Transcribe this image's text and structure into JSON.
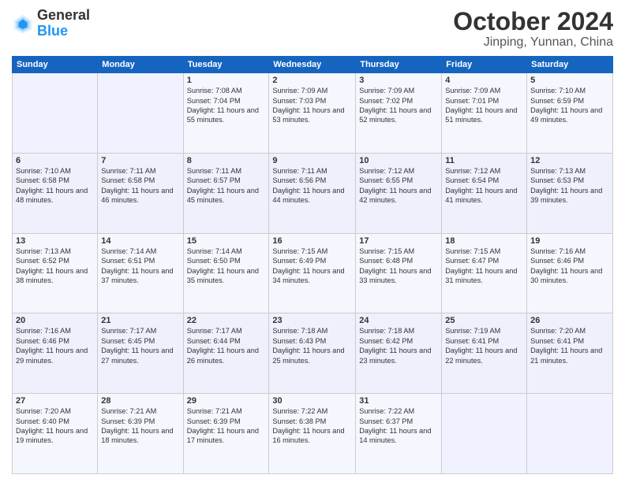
{
  "header": {
    "logo_line1": "General",
    "logo_line2": "Blue",
    "title": "October 2024",
    "subtitle": "Jinping, Yunnan, China"
  },
  "columns": [
    "Sunday",
    "Monday",
    "Tuesday",
    "Wednesday",
    "Thursday",
    "Friday",
    "Saturday"
  ],
  "weeks": [
    [
      {
        "day": "",
        "sunrise": "",
        "sunset": "",
        "daylight": ""
      },
      {
        "day": "",
        "sunrise": "",
        "sunset": "",
        "daylight": ""
      },
      {
        "day": "1",
        "sunrise": "Sunrise: 7:08 AM",
        "sunset": "Sunset: 7:04 PM",
        "daylight": "Daylight: 11 hours and 55 minutes."
      },
      {
        "day": "2",
        "sunrise": "Sunrise: 7:09 AM",
        "sunset": "Sunset: 7:03 PM",
        "daylight": "Daylight: 11 hours and 53 minutes."
      },
      {
        "day": "3",
        "sunrise": "Sunrise: 7:09 AM",
        "sunset": "Sunset: 7:02 PM",
        "daylight": "Daylight: 11 hours and 52 minutes."
      },
      {
        "day": "4",
        "sunrise": "Sunrise: 7:09 AM",
        "sunset": "Sunset: 7:01 PM",
        "daylight": "Daylight: 11 hours and 51 minutes."
      },
      {
        "day": "5",
        "sunrise": "Sunrise: 7:10 AM",
        "sunset": "Sunset: 6:59 PM",
        "daylight": "Daylight: 11 hours and 49 minutes."
      }
    ],
    [
      {
        "day": "6",
        "sunrise": "Sunrise: 7:10 AM",
        "sunset": "Sunset: 6:58 PM",
        "daylight": "Daylight: 11 hours and 48 minutes."
      },
      {
        "day": "7",
        "sunrise": "Sunrise: 7:11 AM",
        "sunset": "Sunset: 6:58 PM",
        "daylight": "Daylight: 11 hours and 46 minutes."
      },
      {
        "day": "8",
        "sunrise": "Sunrise: 7:11 AM",
        "sunset": "Sunset: 6:57 PM",
        "daylight": "Daylight: 11 hours and 45 minutes."
      },
      {
        "day": "9",
        "sunrise": "Sunrise: 7:11 AM",
        "sunset": "Sunset: 6:56 PM",
        "daylight": "Daylight: 11 hours and 44 minutes."
      },
      {
        "day": "10",
        "sunrise": "Sunrise: 7:12 AM",
        "sunset": "Sunset: 6:55 PM",
        "daylight": "Daylight: 11 hours and 42 minutes."
      },
      {
        "day": "11",
        "sunrise": "Sunrise: 7:12 AM",
        "sunset": "Sunset: 6:54 PM",
        "daylight": "Daylight: 11 hours and 41 minutes."
      },
      {
        "day": "12",
        "sunrise": "Sunrise: 7:13 AM",
        "sunset": "Sunset: 6:53 PM",
        "daylight": "Daylight: 11 hours and 39 minutes."
      }
    ],
    [
      {
        "day": "13",
        "sunrise": "Sunrise: 7:13 AM",
        "sunset": "Sunset: 6:52 PM",
        "daylight": "Daylight: 11 hours and 38 minutes."
      },
      {
        "day": "14",
        "sunrise": "Sunrise: 7:14 AM",
        "sunset": "Sunset: 6:51 PM",
        "daylight": "Daylight: 11 hours and 37 minutes."
      },
      {
        "day": "15",
        "sunrise": "Sunrise: 7:14 AM",
        "sunset": "Sunset: 6:50 PM",
        "daylight": "Daylight: 11 hours and 35 minutes."
      },
      {
        "day": "16",
        "sunrise": "Sunrise: 7:15 AM",
        "sunset": "Sunset: 6:49 PM",
        "daylight": "Daylight: 11 hours and 34 minutes."
      },
      {
        "day": "17",
        "sunrise": "Sunrise: 7:15 AM",
        "sunset": "Sunset: 6:48 PM",
        "daylight": "Daylight: 11 hours and 33 minutes."
      },
      {
        "day": "18",
        "sunrise": "Sunrise: 7:15 AM",
        "sunset": "Sunset: 6:47 PM",
        "daylight": "Daylight: 11 hours and 31 minutes."
      },
      {
        "day": "19",
        "sunrise": "Sunrise: 7:16 AM",
        "sunset": "Sunset: 6:46 PM",
        "daylight": "Daylight: 11 hours and 30 minutes."
      }
    ],
    [
      {
        "day": "20",
        "sunrise": "Sunrise: 7:16 AM",
        "sunset": "Sunset: 6:46 PM",
        "daylight": "Daylight: 11 hours and 29 minutes."
      },
      {
        "day": "21",
        "sunrise": "Sunrise: 7:17 AM",
        "sunset": "Sunset: 6:45 PM",
        "daylight": "Daylight: 11 hours and 27 minutes."
      },
      {
        "day": "22",
        "sunrise": "Sunrise: 7:17 AM",
        "sunset": "Sunset: 6:44 PM",
        "daylight": "Daylight: 11 hours and 26 minutes."
      },
      {
        "day": "23",
        "sunrise": "Sunrise: 7:18 AM",
        "sunset": "Sunset: 6:43 PM",
        "daylight": "Daylight: 11 hours and 25 minutes."
      },
      {
        "day": "24",
        "sunrise": "Sunrise: 7:18 AM",
        "sunset": "Sunset: 6:42 PM",
        "daylight": "Daylight: 11 hours and 23 minutes."
      },
      {
        "day": "25",
        "sunrise": "Sunrise: 7:19 AM",
        "sunset": "Sunset: 6:41 PM",
        "daylight": "Daylight: 11 hours and 22 minutes."
      },
      {
        "day": "26",
        "sunrise": "Sunrise: 7:20 AM",
        "sunset": "Sunset: 6:41 PM",
        "daylight": "Daylight: 11 hours and 21 minutes."
      }
    ],
    [
      {
        "day": "27",
        "sunrise": "Sunrise: 7:20 AM",
        "sunset": "Sunset: 6:40 PM",
        "daylight": "Daylight: 11 hours and 19 minutes."
      },
      {
        "day": "28",
        "sunrise": "Sunrise: 7:21 AM",
        "sunset": "Sunset: 6:39 PM",
        "daylight": "Daylight: 11 hours and 18 minutes."
      },
      {
        "day": "29",
        "sunrise": "Sunrise: 7:21 AM",
        "sunset": "Sunset: 6:39 PM",
        "daylight": "Daylight: 11 hours and 17 minutes."
      },
      {
        "day": "30",
        "sunrise": "Sunrise: 7:22 AM",
        "sunset": "Sunset: 6:38 PM",
        "daylight": "Daylight: 11 hours and 16 minutes."
      },
      {
        "day": "31",
        "sunrise": "Sunrise: 7:22 AM",
        "sunset": "Sunset: 6:37 PM",
        "daylight": "Daylight: 11 hours and 14 minutes."
      },
      {
        "day": "",
        "sunrise": "",
        "sunset": "",
        "daylight": ""
      },
      {
        "day": "",
        "sunrise": "",
        "sunset": "",
        "daylight": ""
      }
    ]
  ]
}
